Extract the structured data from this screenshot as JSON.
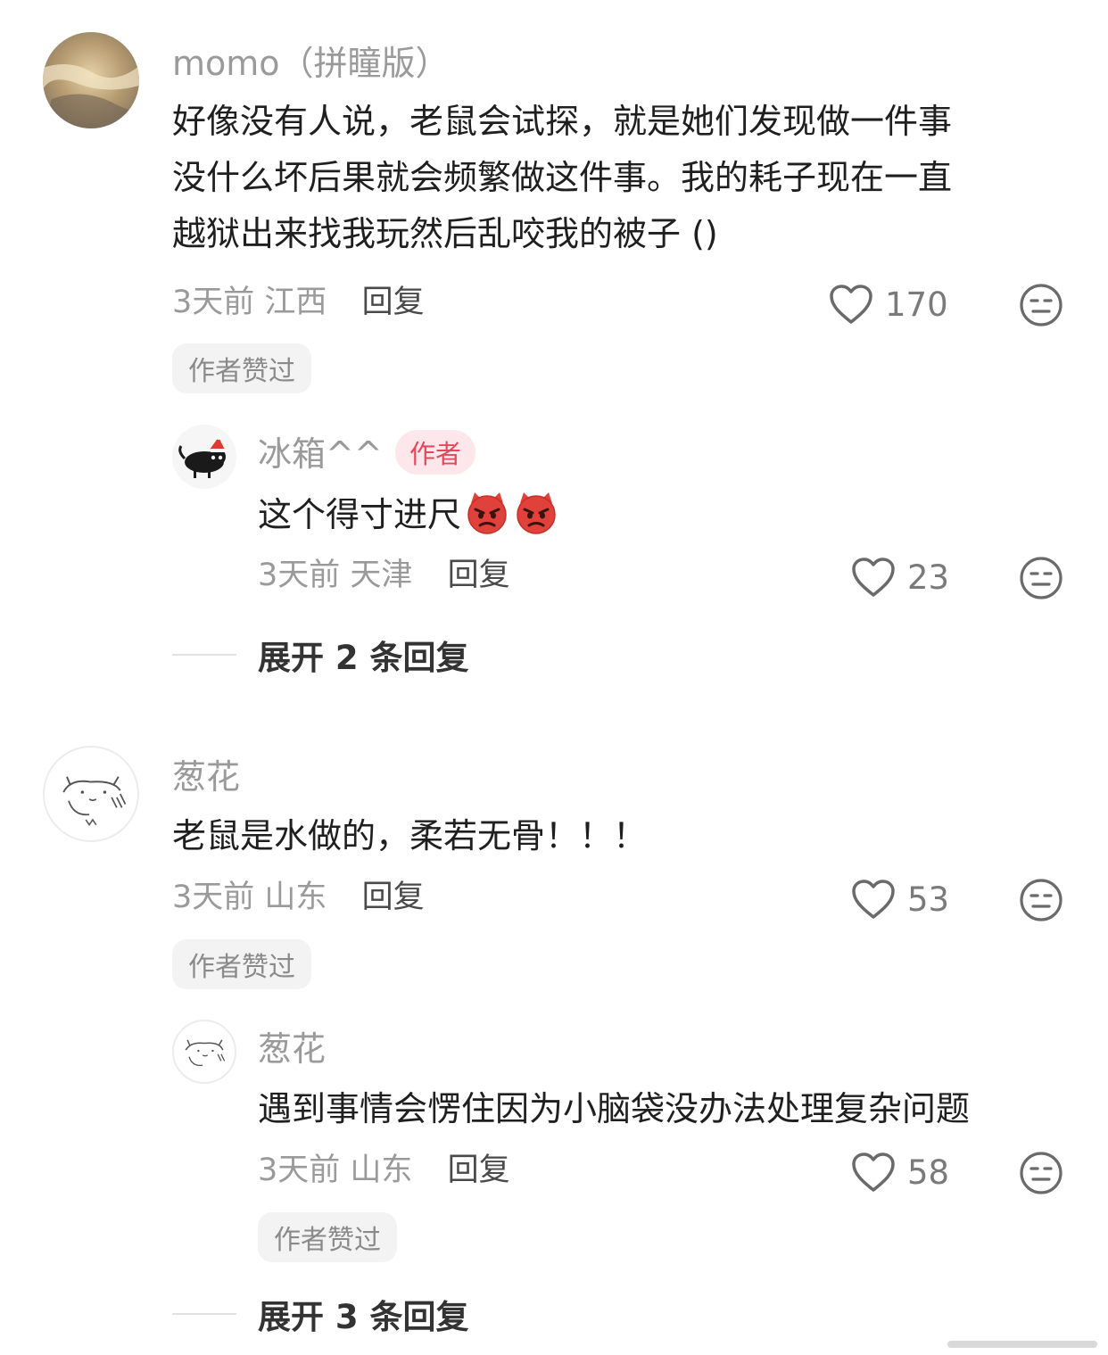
{
  "comments": [
    {
      "user": "momo（拼瞳版）",
      "text_lines": [
        "好像没有人说，老鼠会试探，就是她们发现做一件事",
        "没什么坏后果就会频繁做这件事。我的耗子现在一直",
        "越狱出来找我玩然后乱咬我的被子 ()"
      ],
      "time": "3天前",
      "location": "江西",
      "reply_label": "回复",
      "likes": "170",
      "author_liked": "作者赞过"
    },
    {
      "user": "冰箱^^",
      "author_badge": "作者",
      "text": "这个得寸进尺",
      "time": "3天前",
      "location": "天津",
      "reply_label": "回复",
      "likes": "23",
      "expand": "展开 2 条回复"
    },
    {
      "user": "葱花",
      "text": "老鼠是水做的，柔若无骨！！！",
      "time": "3天前",
      "location": "山东",
      "reply_label": "回复",
      "likes": "53",
      "author_liked": "作者赞过"
    },
    {
      "user": "葱花",
      "text": "遇到事情会愣住因为小脑袋没办法处理复杂问题",
      "time": "3天前",
      "location": "山东",
      "reply_label": "回复",
      "likes": "58",
      "author_liked": "作者赞过",
      "expand": "展开 3 条回复"
    }
  ],
  "icons": {
    "like": "heart-outline-icon",
    "dislike": "neutral-face-icon",
    "emoji": "angry-devil-emoji"
  },
  "colors": {
    "author_badge_bg": "#fde7ea",
    "author_badge_text": "#e4485d",
    "meta_gray": "#9a9a9a"
  }
}
